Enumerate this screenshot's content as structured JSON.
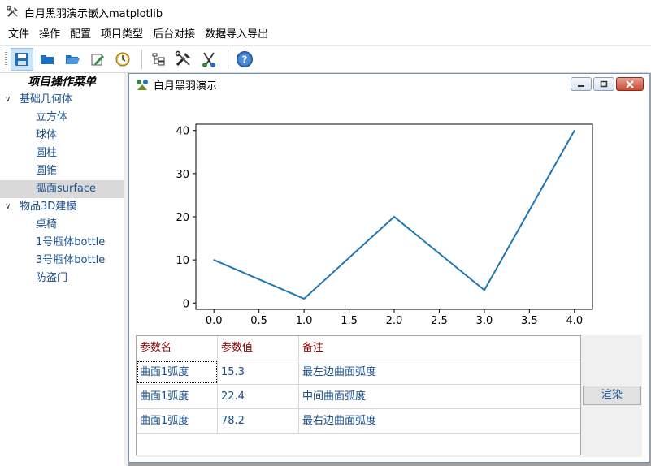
{
  "app": {
    "title": "白月黑羽演示嵌入matplotlib",
    "icon": "tools-icon"
  },
  "menu": [
    "文件",
    "操作",
    "配置",
    "项目类型",
    "后台对接",
    "数据导入导出"
  ],
  "toolbar": {
    "buttons": [
      {
        "name": "save-icon"
      },
      {
        "name": "folder-icon"
      },
      {
        "name": "open-folder-icon"
      },
      {
        "name": "edit-icon"
      },
      {
        "name": "clock-icon"
      },
      {
        "name": "tree-icon"
      },
      {
        "name": "tools-icon"
      },
      {
        "name": "scissors-icon"
      },
      {
        "name": "help-icon"
      }
    ],
    "accent": "#1e6fc0"
  },
  "sidebar": {
    "header": "项目操作菜单",
    "groups": [
      {
        "label": "基础几何体",
        "children": [
          "立方体",
          "球体",
          "圆柱",
          "圆锥",
          "弧面surface"
        ]
      },
      {
        "label": "物品3D建模",
        "children": [
          "桌椅",
          "1号瓶体bottle",
          "3号瓶体bottle",
          "防盗门"
        ]
      }
    ],
    "selected": "弧面surface"
  },
  "subwindow": {
    "title": "白月黑羽演示",
    "icon": "app-logo-icon"
  },
  "chart_data": {
    "type": "line",
    "x": [
      0,
      1,
      2,
      3,
      4
    ],
    "y": [
      10,
      1,
      20,
      3,
      40
    ],
    "xticks": [
      "0.0",
      "0.5",
      "1.0",
      "1.5",
      "2.0",
      "2.5",
      "3.0",
      "3.5",
      "4.0"
    ],
    "yticks": [
      "0",
      "10",
      "20",
      "30",
      "40"
    ],
    "xlim": [
      -0.2,
      4.2
    ],
    "ylim": [
      -1.45,
      41.45
    ],
    "color": "#1f77b4",
    "grid": false
  },
  "table": {
    "columns": [
      "参数名",
      "参数值",
      "备注"
    ],
    "rows": [
      [
        "曲面1弧度",
        "15.3",
        "最左边曲面弧度"
      ],
      [
        "曲面1弧度",
        "22.4",
        "中间曲面弧度"
      ],
      [
        "曲面1弧度",
        "78.2",
        "最右边曲面弧度"
      ]
    ]
  },
  "render_button": "渲染"
}
